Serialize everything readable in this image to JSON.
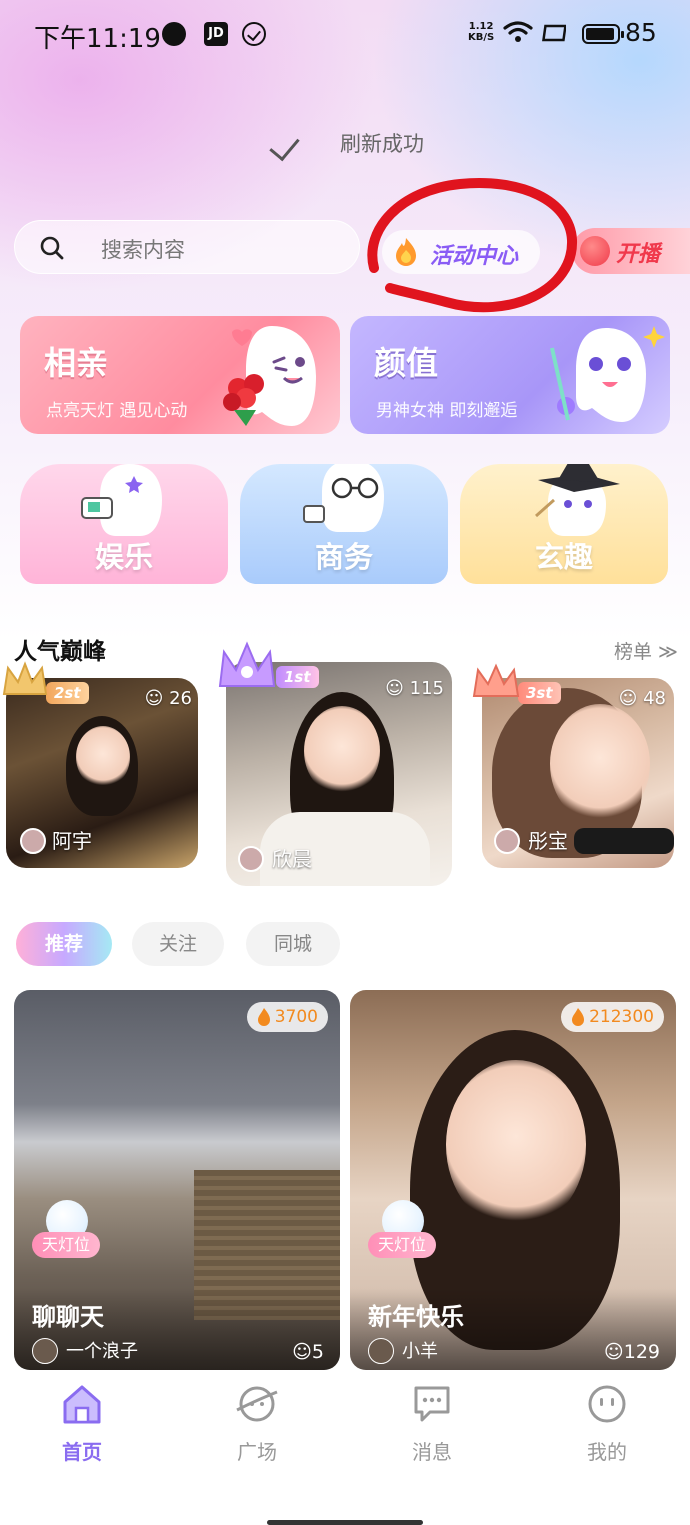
{
  "status_bar": {
    "time": "下午11:19",
    "jd_label": "JD",
    "net_speed_value": "1.12",
    "net_speed_unit": "KB/S",
    "battery": "85"
  },
  "refresh": {
    "text": "刷新成功"
  },
  "header": {
    "search_placeholder": "搜索内容",
    "activity_label": "活动中心",
    "live_label": "开播"
  },
  "categories_big": [
    {
      "title": "相亲",
      "subtitle": "点亮天灯 遇见心动"
    },
    {
      "title": "颜值",
      "subtitle": "男神女神 即刻邂逅"
    }
  ],
  "categories_small": [
    {
      "title": "娱乐"
    },
    {
      "title": "商务"
    },
    {
      "title": "玄趣"
    }
  ],
  "popular": {
    "title": "人气巅峰",
    "link": "榜单 ≫",
    "items": [
      {
        "rank": "2st",
        "viewers": "26",
        "name": "阿宇"
      },
      {
        "rank": "1st",
        "viewers": "115",
        "name": "欣晨"
      },
      {
        "rank": "3st",
        "viewers": "48",
        "name": "彤宝"
      }
    ]
  },
  "tabs": [
    "推荐",
    "关注",
    "同城"
  ],
  "streams": [
    {
      "heat": "3700",
      "badge": "天灯位",
      "title": "聊聊天",
      "host": "一个浪子",
      "viewers": "5"
    },
    {
      "heat": "212300",
      "badge": "天灯位",
      "title": "新年快乐",
      "host": "小羊",
      "viewers": "129"
    }
  ],
  "nav": [
    "首页",
    "广场",
    "消息",
    "我的"
  ],
  "colors": {
    "accent": "#8a6cf0",
    "heat": "#f28a1f",
    "annotation": "#e0141e"
  }
}
